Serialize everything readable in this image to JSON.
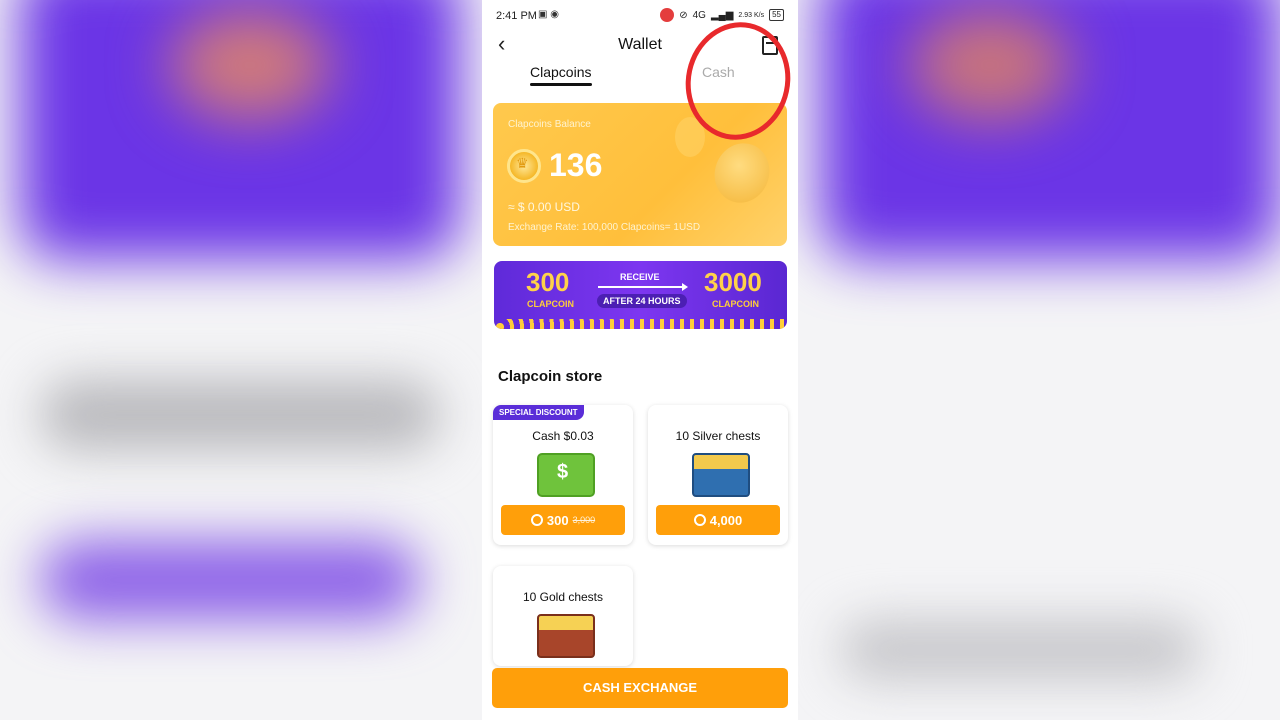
{
  "status_bar": {
    "time": "2:41 PM",
    "network": "4G",
    "speed": "2.93 K/s",
    "battery": "55"
  },
  "header": {
    "title": "Wallet"
  },
  "tabs": [
    {
      "label": "Clapcoins",
      "active": true
    },
    {
      "label": "Cash",
      "active": false
    }
  ],
  "balance_card": {
    "label": "Clapcoins Balance",
    "value": "136",
    "usd": "≈ $ 0.00 USD",
    "rate": "Exchange Rate: 100,000 Clapcoins= 1USD"
  },
  "promo_banner": {
    "from_amount": "300",
    "from_unit": "CLAPCOIN",
    "receive": "RECEIVE",
    "after": "AFTER 24 HOURS",
    "to_amount": "3000",
    "to_unit": "CLAPCOIN"
  },
  "store": {
    "title": "Clapcoin store",
    "items": [
      {
        "badge": "SPECIAL DISCOUNT",
        "title": "Cash $0.03",
        "price": "300",
        "old_price": "3,000",
        "icon": "cash-icon"
      },
      {
        "title": "10 Silver chests",
        "price": "4,000",
        "icon": "silver-chest-icon"
      },
      {
        "title": "10 Gold chests",
        "icon": "gold-chest-icon"
      }
    ]
  },
  "cash_exchange_label": "CASH EXCHANGE",
  "colors": {
    "accent": "#ff9f0a",
    "balance_card": "#ffc94d",
    "banner": "#6a2fe4",
    "annotation": "#e8292c"
  }
}
